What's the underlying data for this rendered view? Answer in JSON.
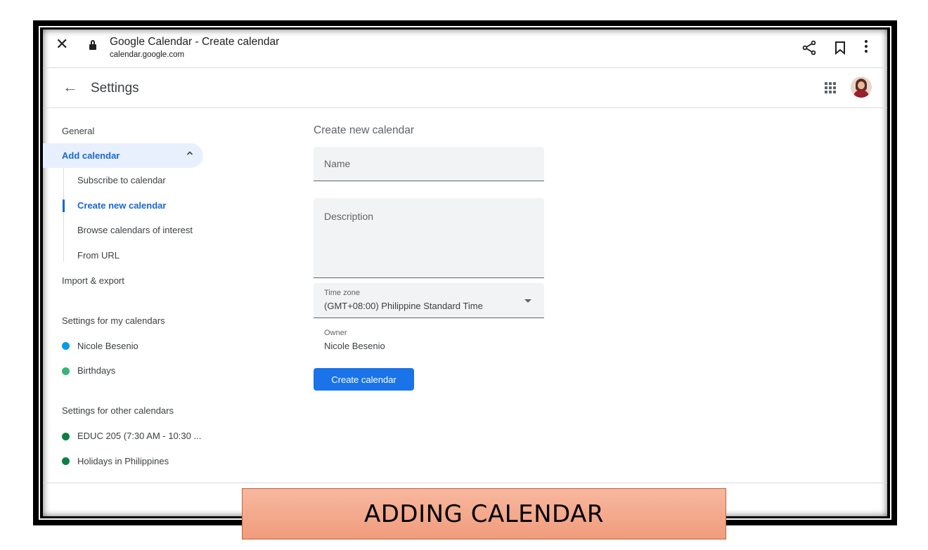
{
  "browser": {
    "page_title": "Google Calendar - Create calendar",
    "url": "calendar.google.com",
    "icons": [
      "close-icon",
      "lock-icon",
      "share-icon",
      "bookmark-icon",
      "more-vert-icon"
    ]
  },
  "header": {
    "title": "Settings",
    "icons": [
      "back-arrow-icon",
      "apps-grid-icon",
      "avatar"
    ]
  },
  "sidebar": {
    "general": "General",
    "add_calendar": "Add calendar",
    "subitems": [
      "Subscribe to calendar",
      "Create new calendar",
      "Browse calendars of interest",
      "From URL"
    ],
    "import_export": "Import & export",
    "my_calendars_heading": "Settings for my calendars",
    "my_calendars": [
      {
        "label": "Nicole Besenio",
        "color": "#039be5"
      },
      {
        "label": "Birthdays",
        "color": "#33b679"
      }
    ],
    "other_calendars_heading": "Settings for other calendars",
    "other_calendars": [
      {
        "label": "EDUC 205 (7:30 AM - 10:30 ...",
        "color": "#0b8043"
      },
      {
        "label": "Holidays in Philippines",
        "color": "#0b8043"
      }
    ],
    "active_color": "#1967d2"
  },
  "form": {
    "title": "Create new calendar",
    "name_placeholder": "Name",
    "description_placeholder": "Description",
    "timezone_label": "Time zone",
    "timezone_value": "(GMT+08:00) Philippine Standard Time",
    "owner_label": "Owner",
    "owner_value": "Nicole Besenio",
    "create_button": "Create calendar",
    "button_color": "#1a73e8"
  },
  "caption": "ADDING CALENDAR"
}
